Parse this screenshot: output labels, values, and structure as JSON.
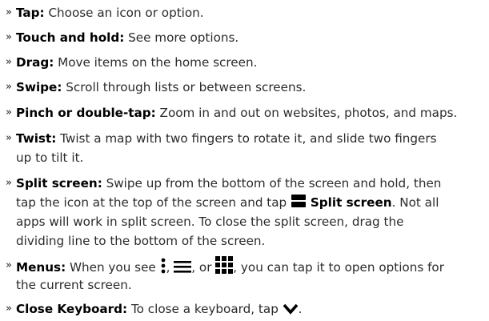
{
  "bullet_glyph": "»",
  "items": [
    {
      "term": "Tap:",
      "lines": [
        "Choose an icon or option."
      ]
    },
    {
      "term": "Touch and hold:",
      "lines": [
        "See more options."
      ]
    },
    {
      "term": "Drag:",
      "lines": [
        "Move items on the home screen."
      ]
    },
    {
      "term": "Swipe:",
      "lines": [
        "Scroll through lists or between screens."
      ]
    },
    {
      "term": "Pinch or double-tap:",
      "lines": [
        "Zoom in and out on websites, photos, and maps."
      ]
    },
    {
      "term": "Twist:",
      "lines": [
        "Twist a map with two fingers to rotate it, and slide two fingers",
        "up to tilt it."
      ]
    },
    {
      "term": "Split screen:",
      "lines": [
        "Swipe up from the bottom of the screen and hold, then",
        "tap the icon at the top of the screen and tap",
        "apps will work in split screen. To close the split screen, drag the",
        "dividing line to the bottom of the screen."
      ],
      "inline_label": "Split screen",
      "after_label": ". Not all"
    },
    {
      "term": "Menus:",
      "lines": [
        "When you see",
        ",",
        ", or",
        ", you can tap it to open options for",
        "the current screen."
      ]
    },
    {
      "term": "Close Keyboard:",
      "lines": [
        "To close a keyboard, tap",
        "."
      ]
    }
  ],
  "icons": {
    "bullet": "chevron-right-double",
    "split": "split-screen-icon",
    "more_vert": "more-vert-icon",
    "menu": "hamburger-menu-icon",
    "apps": "apps-grid-icon",
    "close_keyboard": "chevron-down-icon"
  }
}
